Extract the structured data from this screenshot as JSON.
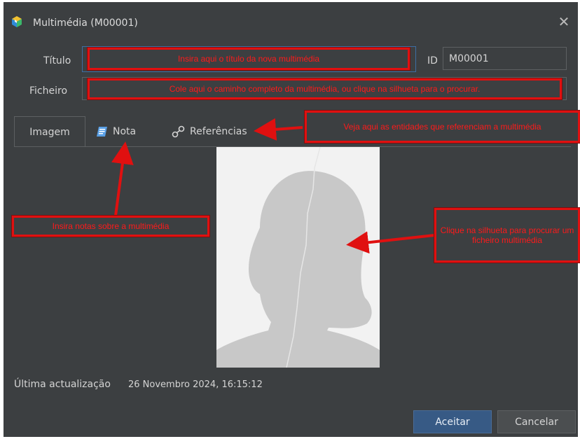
{
  "window": {
    "title": "Multimédia (M00001)",
    "close_symbol": "✕"
  },
  "form": {
    "title_label": "Título",
    "title_value": "",
    "id_label": "ID",
    "id_value": "M00001",
    "file_label": "Ficheiro",
    "file_value": ""
  },
  "tabs": [
    {
      "label": "Imagem",
      "icon": "",
      "active": true
    },
    {
      "label": "Nota",
      "icon": "note-icon",
      "active": false
    },
    {
      "label": "Referências",
      "icon": "link-icon",
      "active": false
    }
  ],
  "annotations": {
    "title_hint": "Insira aqui o título da nova multimédia",
    "file_hint": "Cole aqui o caminho completo da multimédia, ou clique na silhueta para o procurar.",
    "references_hint": "Veja aqui as entidades que referenciam a multimédia",
    "notes_hint": "Insira notas sobre a multimédia",
    "silhouette_hint": "Clique na silhueta para procurar um ficheiro multimédia",
    "color": "#e01010"
  },
  "status": {
    "label": "Última actualização",
    "value": "26 Novembro 2024, 16:15:12"
  },
  "buttons": {
    "ok": "Aceitar",
    "cancel": "Cancelar"
  },
  "colors": {
    "window_bg": "#3c3f41",
    "accent": "#375a85",
    "photo_bg": "#f2f2f2",
    "silhouette": "#c8c8c8"
  }
}
